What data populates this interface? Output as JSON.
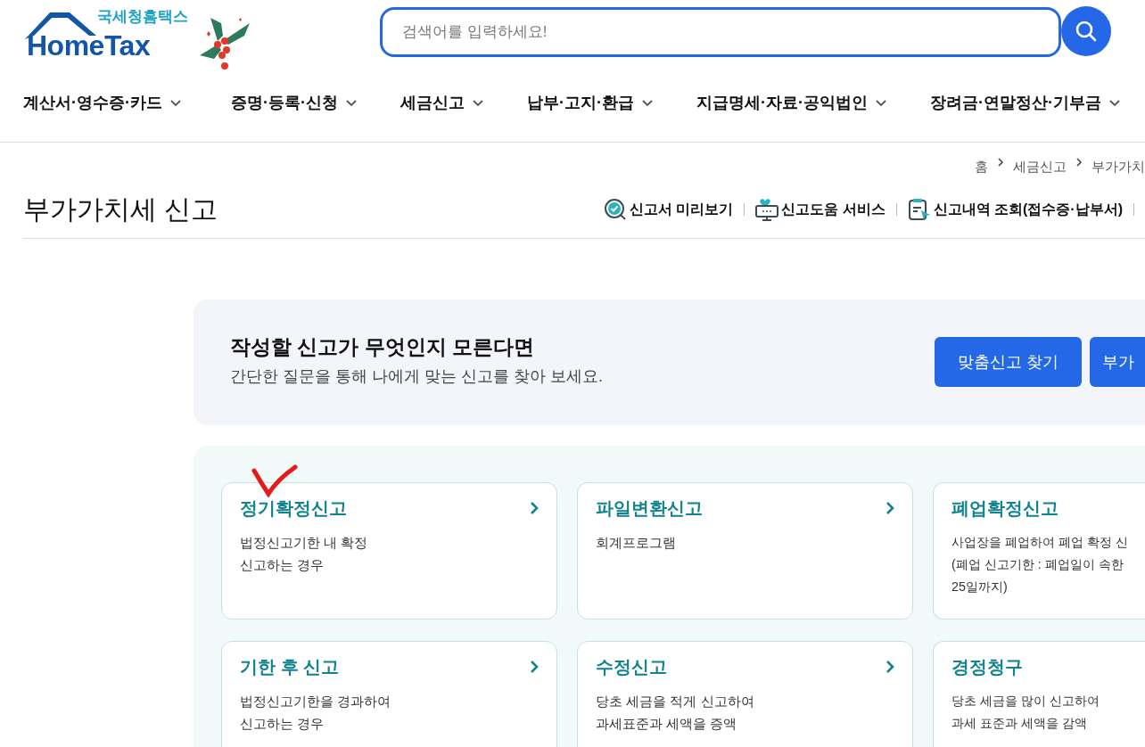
{
  "logo": {
    "subtitle": "국세청홈택스",
    "title": "HomeTax"
  },
  "search": {
    "placeholder": "검색어를 입력하세요!"
  },
  "nav": [
    {
      "label": "계산서·영수증·카드"
    },
    {
      "label": "증명·등록·신청"
    },
    {
      "label": "세금신고"
    },
    {
      "label": "납부·고지·환급"
    },
    {
      "label": "지급명세·자료·공익법인"
    },
    {
      "label": "장려금·연말정산·기부금"
    }
  ],
  "breadcrumb": [
    "홈",
    "세금신고",
    "부가가치"
  ],
  "page_title": "부가가치세 신고",
  "quick_links": [
    {
      "kind": "preview",
      "label": "신고서 미리보기"
    },
    {
      "kind": "help",
      "label": "신고도움 서비스"
    },
    {
      "kind": "history",
      "label": "신고내역 조회(접수증·납부서)"
    }
  ],
  "finder": {
    "title": "작성할 신고가 무엇인지 모른다면",
    "description": "간단한 질문을 통해 나에게 맞는 신고를 찾아 보세요.",
    "buttons": [
      "맞춤신고 찾기",
      "부가"
    ]
  },
  "cards": [
    {
      "title": "정기확정신고",
      "lines": [
        "법정신고기한 내 확정",
        "신고하는 경우"
      ],
      "arrow": true
    },
    {
      "title": "파일변환신고",
      "lines": [
        "회계프로그램"
      ],
      "arrow": true
    },
    {
      "title": "폐업확정신고",
      "lines": [
        "사업장을 폐업하여 폐업 확정 신",
        "(폐업 신고기한 : 폐업일이 속한",
        "25일까지)"
      ],
      "arrow": false
    },
    {
      "title": "기한 후 신고",
      "lines": [
        "법정신고기한을 경과하여",
        "신고하는 경우"
      ],
      "arrow": true
    },
    {
      "title": "수정신고",
      "lines": [
        "당초 세금을 적게 신고하여",
        "과세표준과 세액을 증액"
      ],
      "arrow": true
    },
    {
      "title": "경정청구",
      "lines": [
        "당초 세금을 많이 신고하여",
        "과세 표준과 세액을 감액"
      ],
      "arrow": false
    }
  ]
}
